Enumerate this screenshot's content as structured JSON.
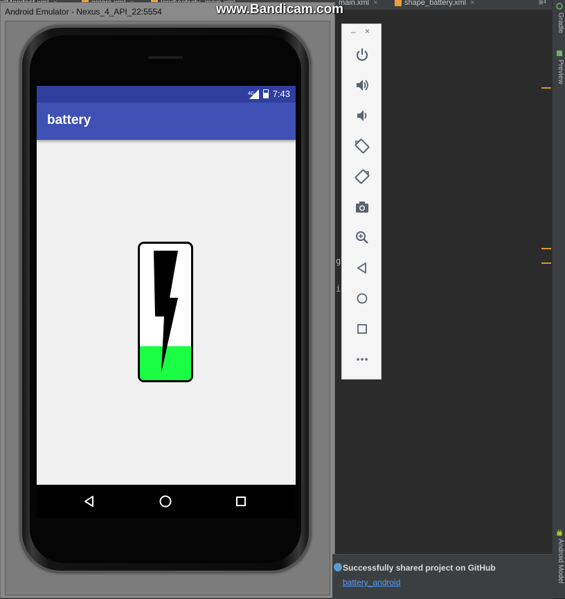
{
  "ide": {
    "tabs": [
      {
        "label": "oidManifest.xml"
      },
      {
        "label": "colors.xml"
      },
      {
        "label": "land\\activity_main.xml"
      },
      {
        "label": "main.xml"
      },
      {
        "label": "shape_battery.xml"
      }
    ],
    "tab_overflow": "≡⁴",
    "side_tabs": {
      "gradle": "Gradle",
      "preview": "Preview",
      "android_model": "Android Model"
    },
    "editor_fragments": [
      "g",
      "i"
    ],
    "notification": {
      "title": "Successfully shared project on GitHub",
      "link": "battery_android"
    }
  },
  "emulator": {
    "title": "Android Emulator - Nexus_4_API_22:5554",
    "watermark": "www.Bandicam.com",
    "toolbar": {
      "minimize": "–",
      "close": "×",
      "buttons": [
        {
          "icon": "power-icon"
        },
        {
          "icon": "volume-up-icon"
        },
        {
          "icon": "volume-down-icon"
        },
        {
          "icon": "rotate-left-icon"
        },
        {
          "icon": "rotate-right-icon"
        },
        {
          "icon": "camera-icon"
        },
        {
          "icon": "zoom-icon"
        },
        {
          "icon": "back-icon"
        },
        {
          "icon": "home-icon"
        },
        {
          "icon": "overview-icon"
        },
        {
          "icon": "more-icon"
        }
      ]
    }
  },
  "device": {
    "status_bar": {
      "network": "4G",
      "time": "7:43"
    },
    "app_bar": {
      "title": "battery"
    },
    "battery": {
      "level_percent": 25,
      "fill_color": "#1aff44"
    },
    "colors": {
      "status_bar": "#303f9f",
      "app_bar": "#3f51b5"
    },
    "nav": [
      {
        "icon": "back-icon"
      },
      {
        "icon": "home-icon"
      },
      {
        "icon": "recents-icon"
      }
    ]
  }
}
